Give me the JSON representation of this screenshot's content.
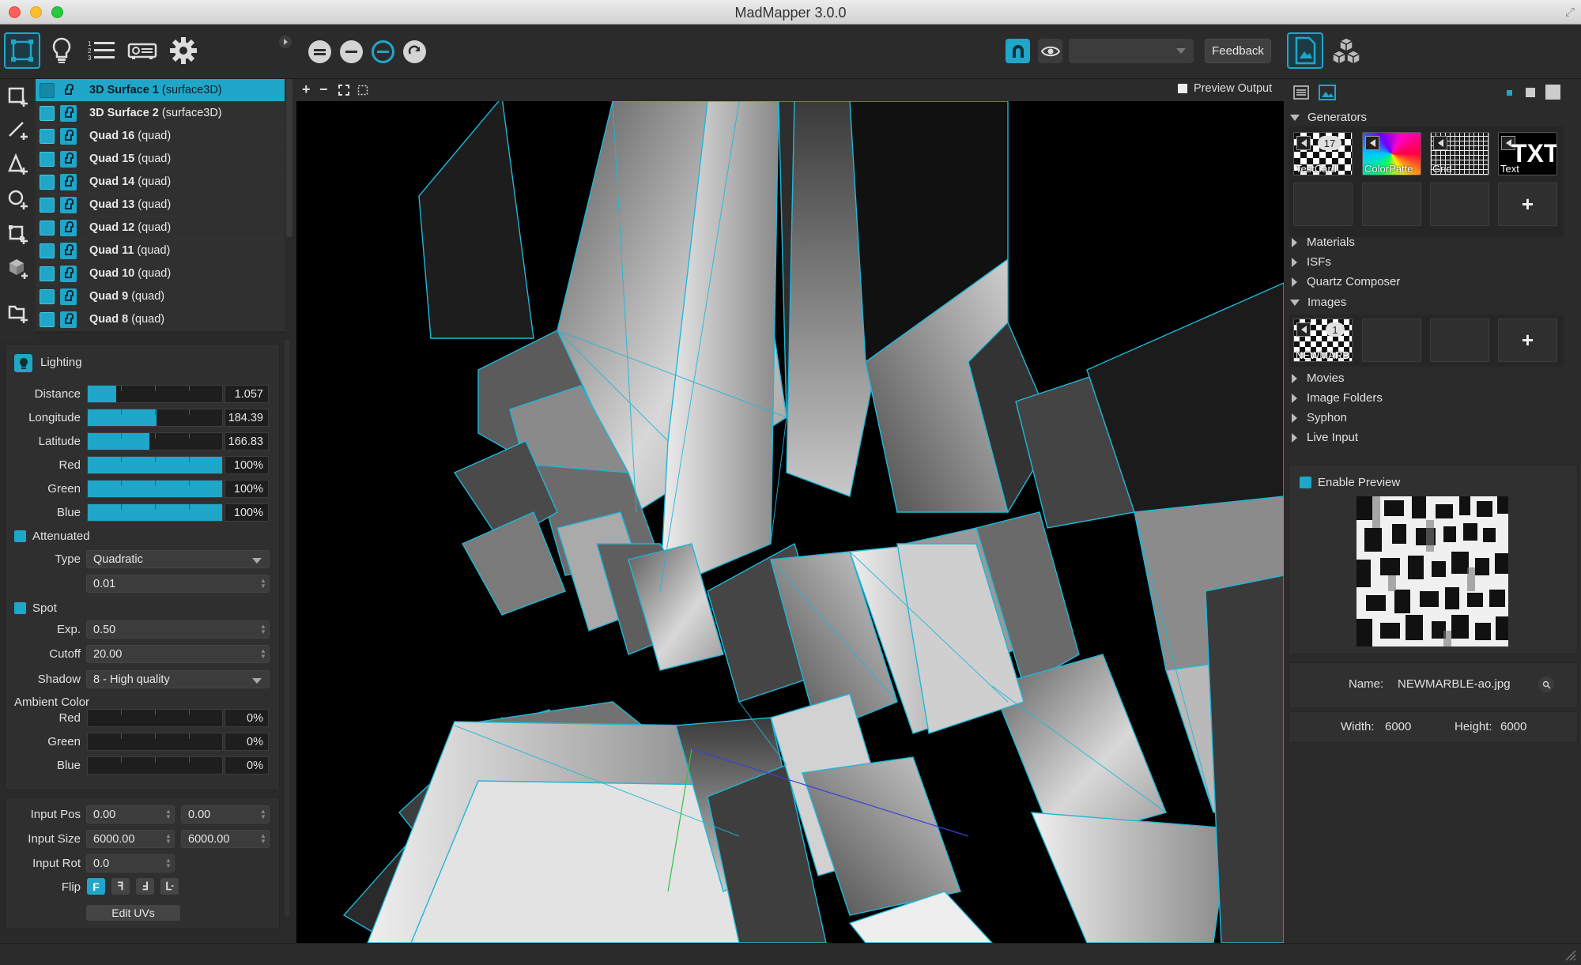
{
  "window": {
    "title": "MadMapper 3.0.0"
  },
  "toolbar": {
    "feedback_label": "Feedback",
    "view_selector_value": ""
  },
  "surfaces": [
    {
      "name": "3D Surface 1",
      "type": "(surface3D)",
      "selected": true
    },
    {
      "name": "3D Surface 2",
      "type": "(surface3D)"
    },
    {
      "name": "Quad 16",
      "type": "(quad)"
    },
    {
      "name": "Quad 15",
      "type": "(quad)"
    },
    {
      "name": "Quad 14",
      "type": "(quad)"
    },
    {
      "name": "Quad 13",
      "type": "(quad)"
    },
    {
      "name": "Quad 12",
      "type": "(quad)"
    },
    {
      "name": "Quad 11",
      "type": "(quad)"
    },
    {
      "name": "Quad 10",
      "type": "(quad)"
    },
    {
      "name": "Quad 9",
      "type": "(quad)"
    },
    {
      "name": "Quad 8",
      "type": "(quad)"
    }
  ],
  "lighting": {
    "header": "Lighting",
    "distance": {
      "label": "Distance",
      "value": "1.057",
      "fraction": 0.21
    },
    "longitude": {
      "label": "Longitude",
      "value": "184.39",
      "fraction": 0.51
    },
    "latitude": {
      "label": "Latitude",
      "value": "166.83",
      "fraction": 0.46
    },
    "red": {
      "label": "Red",
      "value": "100%",
      "fraction": 1.0
    },
    "green": {
      "label": "Green",
      "value": "100%",
      "fraction": 1.0
    },
    "blue": {
      "label": "Blue",
      "value": "100%",
      "fraction": 1.0
    },
    "attenuated_label": "Attenuated",
    "type_label": "Type",
    "type_value": "Quadratic",
    "attenuation_value": "0.01",
    "spot_label": "Spot",
    "exp_label": "Exp.",
    "exp_value": "0.50",
    "cutoff_label": "Cutoff",
    "cutoff_value": "20.00",
    "shadow_label": "Shadow",
    "shadow_value": "8 - High quality",
    "ambient_label": "Ambient Color",
    "amb_red": {
      "label": "Red",
      "value": "0%",
      "fraction": 0
    },
    "amb_green": {
      "label": "Green",
      "value": "0%",
      "fraction": 0
    },
    "amb_blue": {
      "label": "Blue",
      "value": "0%",
      "fraction": 0
    }
  },
  "input": {
    "pos_label": "Input Pos",
    "pos_x": "0.00",
    "pos_y": "0.00",
    "size_label": "Input Size",
    "size_x": "6000.00",
    "size_y": "6000.00",
    "rot_label": "Input Rot",
    "rot_value": "0.0",
    "flip_label": "Flip",
    "flip_buttons": [
      "F",
      "ꟻ",
      "Ⅎ",
      "ᒷ"
    ],
    "edit_uvs_label": "Edit UVs"
  },
  "viewport": {
    "preview_output_label": "Preview Output",
    "zoom_buttons": [
      "+",
      "−"
    ]
  },
  "library": {
    "generators_label": "Generators",
    "generators": [
      {
        "label": "TestCard",
        "count": "17"
      },
      {
        "label": "ColorPatte"
      },
      {
        "label": "Grid"
      },
      {
        "label": "Text",
        "glyph": "TXT"
      }
    ],
    "sections_collapsed": [
      "Materials",
      "ISFs",
      "Quartz Composer"
    ],
    "images_label": "Images",
    "images": [
      {
        "label": "NEWMARB",
        "count": "1"
      }
    ],
    "sections_collapsed_2": [
      "Movies",
      "Image Folders",
      "Syphon",
      "Live Input"
    ],
    "plus": "+"
  },
  "preview": {
    "enable_label": "Enable Preview",
    "name_label": "Name:",
    "name_value": "NEWMARBLE-ao.jpg",
    "width_label": "Width:",
    "width_value": "6000",
    "height_label": "Height:",
    "height_value": "6000"
  },
  "colors": {
    "accent": "#20a6c9",
    "panel": "#2f2f2f",
    "background": "#2a2a2a"
  },
  "icons": [
    "surface-mode-icon",
    "light-bulb-icon",
    "list-icon",
    "projector-icon",
    "gear-icon",
    "media-library-icon",
    "cubes-icon",
    "magnet-icon",
    "eye-icon"
  ]
}
